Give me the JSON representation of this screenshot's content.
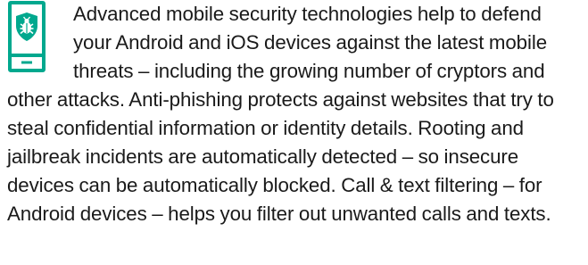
{
  "content": {
    "icon": "mobile-security-bug-shield-icon",
    "accent_color": "#00a88e",
    "paragraph": "Advanced mobile security technologies help to defend your Android and iOS devices against the latest mobile threats – including the growing number of cryptors and other attacks. Anti-phishing protects against websites that try to steal confidential information or identity details. Rooting and jailbreak incidents are automatically detected – so insecure devices can be automatically blocked. Call & text filtering – for Android devices – helps you filter out unwanted calls and texts."
  }
}
